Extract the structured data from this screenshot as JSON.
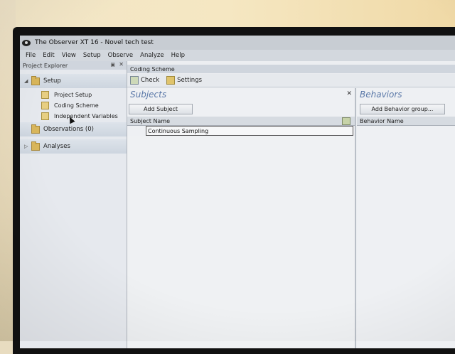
{
  "window": {
    "title": "The Observer XT 16 - Novel tech test"
  },
  "menu": [
    "File",
    "Edit",
    "View",
    "Setup",
    "Observe",
    "Analyze",
    "Help"
  ],
  "explorer": {
    "title": "Project Explorer",
    "pin_icon": "pin-icon",
    "groups": [
      {
        "label": "Setup",
        "expanded": true,
        "children": [
          "Project Setup",
          "Coding Scheme",
          "Independent Variables"
        ]
      },
      {
        "label": "Observations (0)"
      },
      {
        "label": "Analyses",
        "expanded": false
      }
    ]
  },
  "coding_scheme": {
    "tab_title": "Coding Scheme",
    "toolbar": {
      "check_label": "Check",
      "settings_label": "Settings"
    },
    "subjects": {
      "title": "Subjects",
      "add_button": "Add Subject",
      "column_header": "Subject Name",
      "rows": [
        "Continuous Sampling"
      ]
    },
    "behaviors": {
      "title": "Behaviors",
      "add_button": "Add Behavior group...",
      "column_header": "Behavior Name"
    }
  },
  "colors": {
    "section_title": "#5a78a8",
    "bezel": "#111111"
  }
}
